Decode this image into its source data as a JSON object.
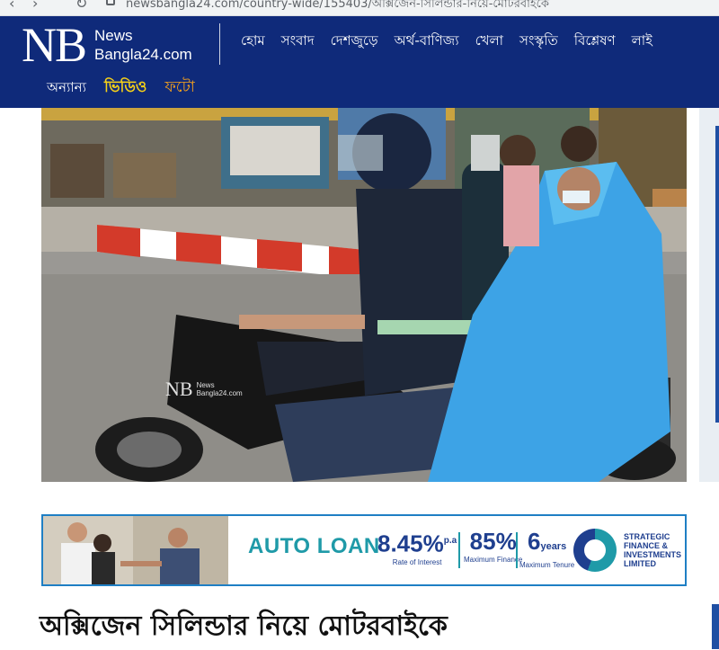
{
  "browser": {
    "url": "newsbangla24.com/country-wide/155403/অক্সিজেন-সিলিন্ডার-নিয়ে-মোটরবাইকে"
  },
  "site": {
    "logo_mark": "NB",
    "logo_line1": "News",
    "logo_line2": "Bangla24.com"
  },
  "main_nav": [
    {
      "label": "হোম"
    },
    {
      "label": "সংবাদ"
    },
    {
      "label": "দেশজুড়ে"
    },
    {
      "label": "অর্থ-বাণিজ্য"
    },
    {
      "label": "খেলা"
    },
    {
      "label": "সংস্কৃতি"
    },
    {
      "label": "বিশ্লেষণ"
    },
    {
      "label": "লাই"
    }
  ],
  "sub_nav": {
    "other": "অন্যান্য",
    "video": "ভিডিও",
    "photo": "ফটো"
  },
  "hero": {
    "watermark_mark": "NB",
    "watermark_line1": "News",
    "watermark_line2": "Bangla24.com"
  },
  "ad": {
    "title": "AUTO LOAN",
    "rate_value": "8.45%",
    "rate_suffix": "p.a",
    "rate_caption": "Rate of Interest",
    "finance_value": "85%",
    "finance_caption": "Maximum Finance",
    "tenure_value": "6",
    "tenure_unit": "years",
    "tenure_caption": "Maximum Tenure",
    "company": "STRATEGIC\nFINANCE &\nINVESTMENTS\nLIMITED"
  },
  "article": {
    "headline": "অক্সিজেন সিলিন্ডার নিয়ে মোটরবাইকে"
  },
  "colors": {
    "header_bg": "#0f2a7a",
    "video_accent": "#f7d117",
    "photo_accent": "#f7a21c",
    "ad_teal": "#1f9aa8",
    "ad_navy": "#1f3f8f"
  }
}
